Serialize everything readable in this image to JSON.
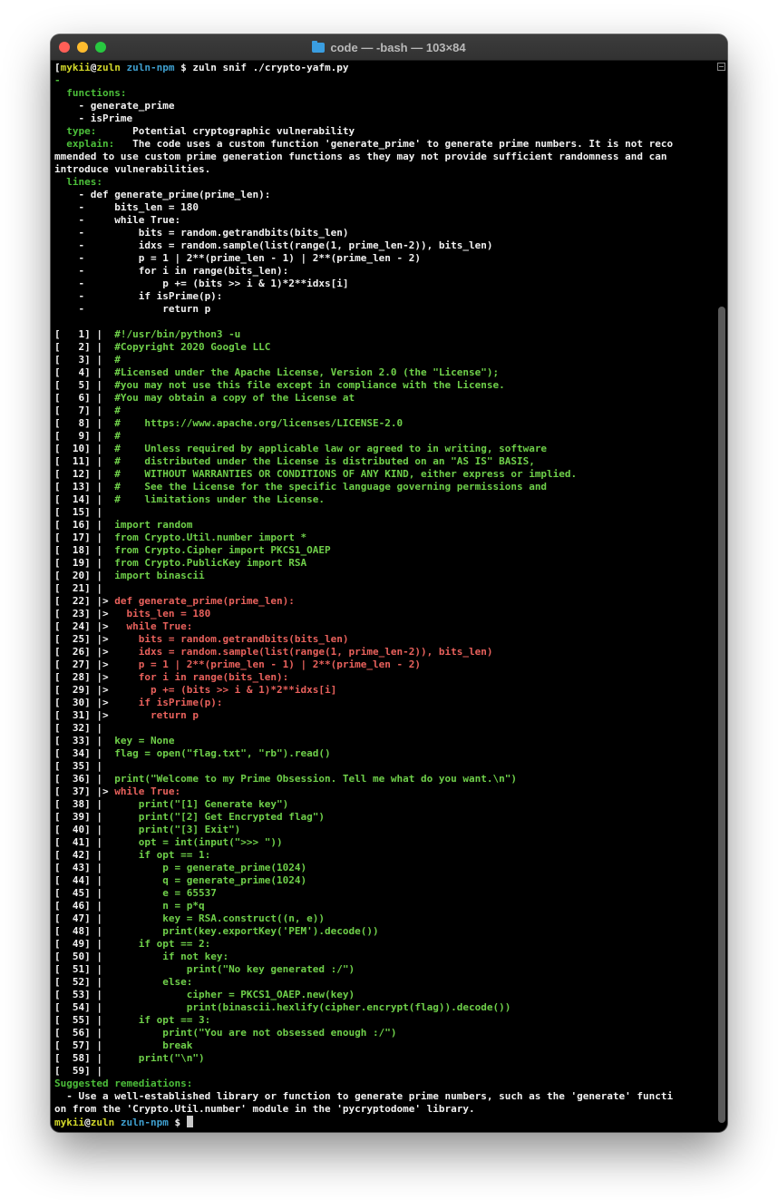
{
  "window": {
    "title": "code — -bash — 103×84"
  },
  "colors": {
    "prompt_user": "#d3d92a",
    "prompt_path": "#3fa0d0",
    "code_green": "#6fd04a",
    "code_red": "#e8615c",
    "default_text": "#f2f2f2"
  },
  "prompt": {
    "user": "mykii",
    "at": "@",
    "host": "zuln",
    "dir": "zuln-npm",
    "symbol": "$",
    "command": "zuln snif ./crypto-yafm.py"
  },
  "lines": [
    [
      [
        "p",
        "[",
        ""
      ],
      [
        "user",
        "mykii",
        ""
      ],
      [
        "",
        "@",
        ""
      ],
      [
        "user",
        "zuln",
        ""
      ],
      [
        "",
        " ",
        ""
      ],
      [
        "path",
        "zuln-npm",
        ""
      ],
      [
        "",
        " $ zuln snif ./crypto-yafm.py",
        ""
      ]
    ],
    [
      [
        "dgrn",
        "-",
        ""
      ]
    ],
    [
      [
        "dgrn",
        "  functions:",
        ""
      ]
    ],
    [
      [
        "",
        "    - generate_prime",
        ""
      ]
    ],
    [
      [
        "",
        "    - isPrime",
        ""
      ]
    ],
    [
      [
        "dgrn",
        "  type:",
        ""
      ],
      [
        "",
        "      Potential cryptographic vulnerability",
        ""
      ]
    ],
    [
      [
        "dgrn",
        "  explain:",
        ""
      ],
      [
        "",
        "   The code uses a custom function 'generate_prime' to generate prime numbers. It is not reco",
        ""
      ]
    ],
    [
      [
        "",
        "mmended to use custom prime generation functions as they may not provide sufficient randomness and can",
        ""
      ]
    ],
    [
      [
        "",
        "introduce vulnerabilities.",
        ""
      ]
    ],
    [
      [
        "dgrn",
        "  lines:",
        ""
      ]
    ],
    [
      [
        "",
        "    - def generate_prime(prime_len):",
        ""
      ]
    ],
    [
      [
        "",
        "    -     bits_len = 180",
        ""
      ]
    ],
    [
      [
        "",
        "    -     while True:",
        ""
      ]
    ],
    [
      [
        "",
        "    -         bits = random.getrandbits(bits_len)",
        ""
      ]
    ],
    [
      [
        "",
        "    -         idxs = random.sample(list(range(1, prime_len-2)), bits_len)",
        ""
      ]
    ],
    [
      [
        "",
        "    -         p = 1 | 2**(prime_len - 1) | 2**(prime_len - 2)",
        ""
      ]
    ],
    [
      [
        "",
        "    -         for i in range(bits_len):",
        ""
      ]
    ],
    [
      [
        "",
        "    -             p += (bits >> i & 1)*2**idxs[i]",
        ""
      ]
    ],
    [
      [
        "",
        "    -         if isPrime(p):",
        ""
      ]
    ],
    [
      [
        "",
        "    -             return p",
        ""
      ]
    ],
    [
      [
        "",
        "",
        ""
      ]
    ],
    [
      [
        "",
        "[   1] |  ",
        ""
      ],
      [
        "grn",
        "#!/usr/bin/python3 -u",
        ""
      ]
    ],
    [
      [
        "",
        "[   2] |  ",
        ""
      ],
      [
        "grn",
        "#Copyright 2020 Google LLC",
        ""
      ]
    ],
    [
      [
        "",
        "[   3] |  ",
        ""
      ],
      [
        "grn",
        "#",
        ""
      ]
    ],
    [
      [
        "",
        "[   4] |  ",
        ""
      ],
      [
        "grn",
        "#Licensed under the Apache License, Version 2.0 (the \"License\");",
        ""
      ]
    ],
    [
      [
        "",
        "[   5] |  ",
        ""
      ],
      [
        "grn",
        "#you may not use this file except in compliance with the License.",
        ""
      ]
    ],
    [
      [
        "",
        "[   6] |  ",
        ""
      ],
      [
        "grn",
        "#You may obtain a copy of the License at",
        ""
      ]
    ],
    [
      [
        "",
        "[   7] |  ",
        ""
      ],
      [
        "grn",
        "#",
        ""
      ]
    ],
    [
      [
        "",
        "[   8] |  ",
        ""
      ],
      [
        "grn",
        "#    https://www.apache.org/licenses/LICENSE-2.0",
        ""
      ]
    ],
    [
      [
        "",
        "[   9] |  ",
        ""
      ],
      [
        "grn",
        "#",
        ""
      ]
    ],
    [
      [
        "",
        "[  10] |  ",
        ""
      ],
      [
        "grn",
        "#    Unless required by applicable law or agreed to in writing, software",
        ""
      ]
    ],
    [
      [
        "",
        "[  11] |  ",
        ""
      ],
      [
        "grn",
        "#    distributed under the License is distributed on an \"AS IS\" BASIS,",
        ""
      ]
    ],
    [
      [
        "",
        "[  12] |  ",
        ""
      ],
      [
        "grn",
        "#    WITHOUT WARRANTIES OR CONDITIONS OF ANY KIND, either express or implied.",
        ""
      ]
    ],
    [
      [
        "",
        "[  13] |  ",
        ""
      ],
      [
        "grn",
        "#    See the License for the specific language governing permissions and",
        ""
      ]
    ],
    [
      [
        "",
        "[  14] |  ",
        ""
      ],
      [
        "grn",
        "#    limitations under the License.",
        ""
      ]
    ],
    [
      [
        "",
        "[  15] |",
        ""
      ]
    ],
    [
      [
        "",
        "[  16] |  ",
        ""
      ],
      [
        "grn",
        "import random",
        ""
      ]
    ],
    [
      [
        "",
        "[  17] |  ",
        ""
      ],
      [
        "grn",
        "from Crypto.Util.number import *",
        ""
      ]
    ],
    [
      [
        "",
        "[  18] |  ",
        ""
      ],
      [
        "grn",
        "from Crypto.Cipher import PKCS1_OAEP",
        ""
      ]
    ],
    [
      [
        "",
        "[  19] |  ",
        ""
      ],
      [
        "grn",
        "from Crypto.PublicKey import RSA",
        ""
      ]
    ],
    [
      [
        "",
        "[  20] |  ",
        ""
      ],
      [
        "grn",
        "import binascii",
        ""
      ]
    ],
    [
      [
        "",
        "[  21] |",
        ""
      ]
    ],
    [
      [
        "",
        "[  22] |> ",
        ""
      ],
      [
        "red",
        "def generate_prime(prime_len):",
        ""
      ]
    ],
    [
      [
        "",
        "[  23] |> ",
        ""
      ],
      [
        "red",
        "  bits_len = 180",
        ""
      ]
    ],
    [
      [
        "",
        "[  24] |> ",
        ""
      ],
      [
        "red",
        "  while True:",
        ""
      ]
    ],
    [
      [
        "",
        "[  25] |> ",
        ""
      ],
      [
        "red",
        "    bits = random.getrandbits(bits_len)",
        ""
      ]
    ],
    [
      [
        "",
        "[  26] |> ",
        ""
      ],
      [
        "red",
        "    idxs = random.sample(list(range(1, prime_len-2)), bits_len)",
        ""
      ]
    ],
    [
      [
        "",
        "[  27] |> ",
        ""
      ],
      [
        "red",
        "    p = 1 | 2**(prime_len - 1) | 2**(prime_len - 2)",
        ""
      ]
    ],
    [
      [
        "",
        "[  28] |> ",
        ""
      ],
      [
        "red",
        "    for i in range(bits_len):",
        ""
      ]
    ],
    [
      [
        "",
        "[  29] |> ",
        ""
      ],
      [
        "red",
        "      p += (bits >> i & 1)*2**idxs[i]",
        ""
      ]
    ],
    [
      [
        "",
        "[  30] |> ",
        ""
      ],
      [
        "red",
        "    if isPrime(p):",
        ""
      ]
    ],
    [
      [
        "",
        "[  31] |> ",
        ""
      ],
      [
        "red",
        "      return p",
        ""
      ]
    ],
    [
      [
        "",
        "[  32] |",
        ""
      ]
    ],
    [
      [
        "",
        "[  33] |  ",
        ""
      ],
      [
        "grn",
        "key = None",
        ""
      ]
    ],
    [
      [
        "",
        "[  34] |  ",
        ""
      ],
      [
        "grn",
        "flag = open(\"flag.txt\", \"rb\").read()",
        ""
      ]
    ],
    [
      [
        "",
        "[  35] |",
        ""
      ]
    ],
    [
      [
        "",
        "[  36] |  ",
        ""
      ],
      [
        "grn",
        "print(\"Welcome to my Prime Obsession. Tell me what do you want.\\n\")",
        ""
      ]
    ],
    [
      [
        "",
        "[  37] |> ",
        ""
      ],
      [
        "red",
        "while True:",
        ""
      ]
    ],
    [
      [
        "",
        "[  38] |  ",
        ""
      ],
      [
        "grn",
        "    print(\"[1] Generate key\")",
        ""
      ]
    ],
    [
      [
        "",
        "[  39] |  ",
        ""
      ],
      [
        "grn",
        "    print(\"[2] Get Encrypted flag\")",
        ""
      ]
    ],
    [
      [
        "",
        "[  40] |  ",
        ""
      ],
      [
        "grn",
        "    print(\"[3] Exit\")",
        ""
      ]
    ],
    [
      [
        "",
        "[  41] |  ",
        ""
      ],
      [
        "grn",
        "    opt = int(input(\">>> \"))",
        ""
      ]
    ],
    [
      [
        "",
        "[  42] |  ",
        ""
      ],
      [
        "grn",
        "    if opt == 1:",
        ""
      ]
    ],
    [
      [
        "",
        "[  43] |  ",
        ""
      ],
      [
        "grn",
        "        p = generate_prime(1024)",
        ""
      ]
    ],
    [
      [
        "",
        "[  44] |  ",
        ""
      ],
      [
        "grn",
        "        q = generate_prime(1024)",
        ""
      ]
    ],
    [
      [
        "",
        "[  45] |  ",
        ""
      ],
      [
        "grn",
        "        e = 65537",
        ""
      ]
    ],
    [
      [
        "",
        "[  46] |  ",
        ""
      ],
      [
        "grn",
        "        n = p*q",
        ""
      ]
    ],
    [
      [
        "",
        "[  47] |  ",
        ""
      ],
      [
        "grn",
        "        key = RSA.construct((n, e))",
        ""
      ]
    ],
    [
      [
        "",
        "[  48] |  ",
        ""
      ],
      [
        "grn",
        "        print(key.exportKey('PEM').decode())",
        ""
      ]
    ],
    [
      [
        "",
        "[  49] |  ",
        ""
      ],
      [
        "grn",
        "    if opt == 2:",
        ""
      ]
    ],
    [
      [
        "",
        "[  50] |  ",
        ""
      ],
      [
        "grn",
        "        if not key:",
        ""
      ]
    ],
    [
      [
        "",
        "[  51] |  ",
        ""
      ],
      [
        "grn",
        "            print(\"No key generated :/\")",
        ""
      ]
    ],
    [
      [
        "",
        "[  52] |  ",
        ""
      ],
      [
        "grn",
        "        else:",
        ""
      ]
    ],
    [
      [
        "",
        "[  53] |  ",
        ""
      ],
      [
        "grn",
        "            cipher = PKCS1_OAEP.new(key)",
        ""
      ]
    ],
    [
      [
        "",
        "[  54] |  ",
        ""
      ],
      [
        "grn",
        "            print(binascii.hexlify(cipher.encrypt(flag)).decode())",
        ""
      ]
    ],
    [
      [
        "",
        "[  55] |  ",
        ""
      ],
      [
        "grn",
        "    if opt == 3:",
        ""
      ]
    ],
    [
      [
        "",
        "[  56] |  ",
        ""
      ],
      [
        "grn",
        "        print(\"You are not obsessed enough :/\")",
        ""
      ]
    ],
    [
      [
        "",
        "[  57] |  ",
        ""
      ],
      [
        "grn",
        "        break",
        ""
      ]
    ],
    [
      [
        "",
        "[  58] |  ",
        ""
      ],
      [
        "grn",
        "    print(\"\\n\")",
        ""
      ]
    ],
    [
      [
        "",
        "[  59] |",
        ""
      ]
    ],
    [
      [
        "dgrn",
        "Suggested remediations:",
        ""
      ]
    ],
    [
      [
        "",
        "  - Use a well-established library or function to generate prime numbers, such as the 'generate' functi",
        ""
      ]
    ],
    [
      [
        "",
        "on from the 'Crypto.Util.number' module in the 'pycryptodome' library.",
        ""
      ]
    ],
    [
      [
        "user",
        "mykii",
        ""
      ],
      [
        "",
        "@",
        ""
      ],
      [
        "user",
        "zuln",
        ""
      ],
      [
        "",
        " ",
        ""
      ],
      [
        "path",
        "zuln-npm",
        ""
      ],
      [
        "",
        " $ ",
        ""
      ]
    ]
  ]
}
